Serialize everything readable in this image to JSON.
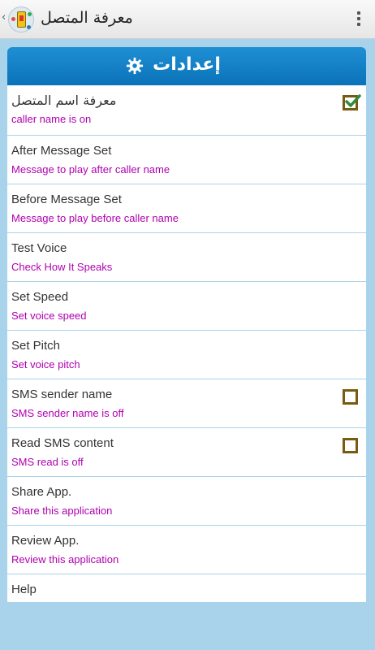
{
  "actionbar": {
    "title": "معرفة المتصل",
    "up_caret": "‹",
    "icon": "app-icon",
    "menu_icon": "overflow-menu-icon"
  },
  "header": {
    "title": "إعدادات",
    "icon": "gear-icon"
  },
  "colors": {
    "header": "#1584c8",
    "subtitle": "#b000b0",
    "checkbox": "#7a5a12",
    "background": "#a9d3ea"
  },
  "settings": [
    {
      "title": "معرفة اسم المتصل",
      "subtitle": "caller name is on",
      "checkbox": true,
      "checked": true
    },
    {
      "title": "After Message Set",
      "subtitle": "Message to play after caller name"
    },
    {
      "title": "Before Message Set",
      "subtitle": "Message to play before caller name"
    },
    {
      "title": "Test Voice",
      "subtitle": "Check How It Speaks"
    },
    {
      "title": "Set Speed",
      "subtitle": "Set voice speed"
    },
    {
      "title": "Set Pitch",
      "subtitle": "Set voice pitch"
    },
    {
      "title": "SMS sender name",
      "subtitle": "SMS sender name is off",
      "checkbox": true,
      "checked": false
    },
    {
      "title": "Read SMS content",
      "subtitle": "SMS read is off",
      "checkbox": true,
      "checked": false
    },
    {
      "title": "Share App.",
      "subtitle": "Share this application"
    },
    {
      "title": "Review App.",
      "subtitle": "Review this application"
    },
    {
      "title": "Help",
      "subtitle": ""
    }
  ]
}
